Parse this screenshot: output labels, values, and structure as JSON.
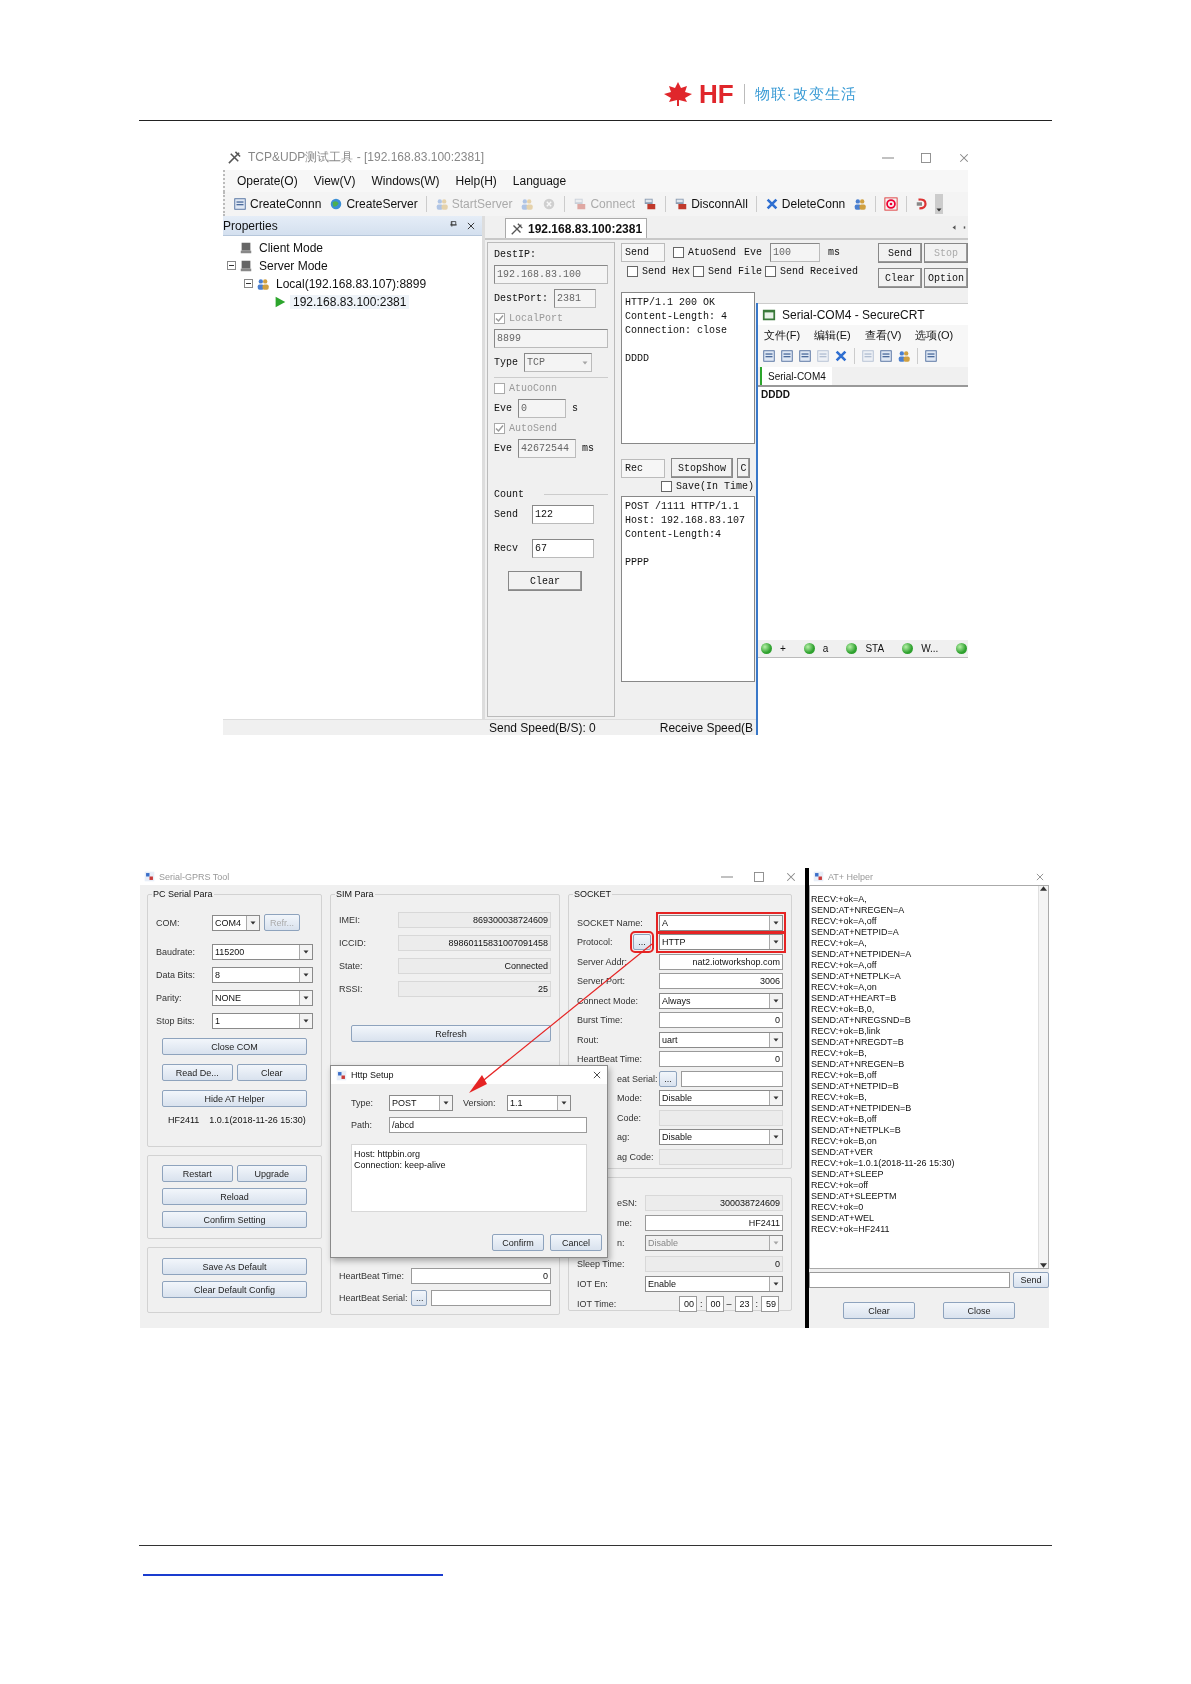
{
  "header": {
    "brand": "HF",
    "slogan": "物联·改变生活"
  },
  "tcp_tool": {
    "title": "TCP&UDP测试工具 - [192.168.83.100:2381]",
    "menu": [
      "Operate(O)",
      "View(V)",
      "Windows(W)",
      "Help(H)",
      "Language"
    ],
    "toolbar": [
      {
        "kind": "button",
        "label": "CreateConnn",
        "disabled": false
      },
      {
        "kind": "button",
        "label": "CreateServer",
        "disabled": false
      },
      {
        "kind": "separator"
      },
      {
        "kind": "button",
        "label": "StartServer",
        "disabled": true
      },
      {
        "kind": "icon",
        "disabled": true
      },
      {
        "kind": "icon",
        "disabled": true
      },
      {
        "kind": "separator"
      },
      {
        "kind": "button",
        "label": "Connect",
        "disabled": true
      },
      {
        "kind": "icon",
        "disabled": false
      },
      {
        "kind": "separator"
      },
      {
        "kind": "button",
        "label": "DisconnAll",
        "disabled": false
      },
      {
        "kind": "separator"
      },
      {
        "kind": "button",
        "label": "DeleteConn",
        "disabled": false
      },
      {
        "kind": "icon",
        "disabled": false
      },
      {
        "kind": "separator"
      },
      {
        "kind": "icon",
        "disabled": false
      },
      {
        "kind": "separator"
      },
      {
        "kind": "icon",
        "disabled": false
      }
    ],
    "properties": {
      "title": "Properties",
      "tree": [
        {
          "label": "Client Mode",
          "selected": false
        },
        {
          "label": "Server Mode",
          "expanded": true,
          "selected": false,
          "children": [
            {
              "label": "Local(192.168.83.107):8899",
              "expanded": true,
              "selected": false,
              "children": [
                {
                  "label": "192.168.83.100:2381",
                  "selected": true
                }
              ]
            }
          ]
        }
      ]
    },
    "tab": {
      "label": "192.168.83.100:2381",
      "selected": true
    },
    "settings": {
      "dest_ip": {
        "label": "DestIP:",
        "value": "192.168.83.100",
        "disabled": true
      },
      "dest_port": {
        "label": "DestPort:",
        "value": "2381",
        "disabled": true
      },
      "local_port": {
        "label": "LocalPort",
        "checked": true,
        "disabled": true,
        "value": "8899"
      },
      "type": {
        "label": "Type",
        "value": "TCP",
        "disabled": true
      },
      "auto_conn": {
        "label": "AtuoConn",
        "checked": false,
        "disabled": true,
        "eve_label": "Eve",
        "value": "0",
        "unit": "s"
      },
      "auto_send": {
        "label": "AutoSend",
        "checked": true,
        "disabled": true,
        "eve_label": "Eve",
        "value": "42672544",
        "unit": "ms"
      },
      "count": {
        "title": "Count",
        "send_label": "Send",
        "send": "122",
        "recv_label": "Recv",
        "recv": "67",
        "clear": "Clear"
      }
    },
    "send_panel": {
      "send_box": "Send",
      "atuo_send": {
        "label": "AtuoSend",
        "checked": false
      },
      "eve_label": "Eve",
      "eve_value": "100",
      "eve_unit": "ms",
      "buttons": [
        {
          "label": "Send",
          "disabled": false
        },
        {
          "label": "Stop",
          "disabled": true
        },
        {
          "label": "Clear",
          "disabled": false
        },
        {
          "label": "Option",
          "disabled": false
        }
      ],
      "options": [
        {
          "label": "Send Hex",
          "checked": false
        },
        {
          "label": "Send File",
          "checked": false
        },
        {
          "label": "Send Received",
          "checked": false
        }
      ],
      "text": "HTTP/1.1 200 OK\nContent-Length: 4\nConnection: close\n\nDDDD"
    },
    "recv_panel": {
      "rec_box": "Rec",
      "buttons": [
        "StopShow",
        "C"
      ],
      "save": {
        "label": "Save(In Time)",
        "checked": false
      },
      "text": "POST /1111 HTTP/1.1\nHost: 192.168.83.107\nContent-Length:4\n\nPPPP"
    },
    "status": [
      "Send Speed(B/S): 0",
      "Receive Speed(B"
    ]
  },
  "securecrt": {
    "title": "Serial-COM4 - SecureCRT",
    "menu": [
      "文件(F)",
      "编辑(E)",
      "查看(V)",
      "选项(O)"
    ],
    "tab": {
      "label": "Serial-COM4",
      "selected": true
    },
    "text": "DDDD",
    "status": [
      {
        "kind": "labeled",
        "label": "+"
      },
      {
        "kind": "labeled",
        "label": "a"
      },
      {
        "kind": "labeled",
        "label": "STA"
      },
      {
        "kind": "labeled",
        "label": "W..."
      },
      {
        "kind": "dot"
      }
    ]
  },
  "gprs_tool": {
    "title": "Serial-GPRS Tool",
    "pc_serial": {
      "title": "PC Serial Para",
      "com": {
        "label": "COM:",
        "value": "COM4",
        "refresh": "Refr..."
      },
      "fields": [
        {
          "label": "Baudrate:",
          "value": "115200"
        },
        {
          "label": "Data Bits:",
          "value": "8"
        },
        {
          "label": "Parity:",
          "value": "NONE"
        },
        {
          "label": "Stop Bits:",
          "value": "1"
        }
      ],
      "close": "Close COM",
      "read": "Read De...",
      "clear": "Clear",
      "hide": "Hide AT Helper",
      "model": "HF2411",
      "version": "1.0.1(2018-11-26 15:30)"
    },
    "device_buttons": [
      [
        "Restart",
        "Upgrade"
      ],
      [
        "Reload"
      ],
      [
        "Confirm Setting"
      ]
    ],
    "default_buttons": [
      "Save As Default",
      "Clear Default Config"
    ],
    "sim": {
      "title": "SIM Para",
      "fields": [
        {
          "label": "IMEI:",
          "value": "869300038724609"
        },
        {
          "label": "ICCID:",
          "value": "89860115831007091458"
        },
        {
          "label": "State:",
          "value": "Connected"
        },
        {
          "label": "RSSI:",
          "value": "25"
        }
      ],
      "refresh": "Refresh"
    },
    "heartbeat": {
      "time_label": "HeartBeat Time:",
      "time": "0",
      "serial_label": "HeartBeat Serial:",
      "more": "..."
    },
    "socket": {
      "title": "SOCKET",
      "fields": [
        {
          "kind": "select",
          "label": "SOCKET Name:",
          "value": "A",
          "highlighted": true
        },
        {
          "kind": "select",
          "label": "Protocol:",
          "value": "HTTP",
          "more": "...",
          "highlighted": true
        },
        {
          "kind": "input",
          "label": "Server Addr:",
          "value": "nat2.iotworkshop.com"
        },
        {
          "kind": "input",
          "label": "Server Port:",
          "value": "3006"
        },
        {
          "kind": "select",
          "label": "Connect Mode:",
          "value": "Always"
        },
        {
          "kind": "input",
          "label": "Burst Time:",
          "value": "0"
        },
        {
          "kind": "select",
          "label": "Rout:",
          "value": "uart"
        },
        {
          "kind": "input",
          "label": "HeartBeat Time:",
          "value": "0"
        },
        {
          "kind": "more_input",
          "label": "eat Serial:",
          "more": "...",
          "partly_covered": true
        },
        {
          "kind": "select",
          "label": "Mode:",
          "value": "Disable",
          "partly_covered": true
        },
        {
          "kind": "input",
          "label": "Code:",
          "disabled": true,
          "partly_covered": true
        },
        {
          "kind": "select",
          "label": "ag:",
          "value": "Disable",
          "partly_covered": true
        },
        {
          "kind": "input",
          "label": "ag Code:",
          "disabled": true,
          "partly_covered": true
        }
      ]
    },
    "socket2": {
      "fields": [
        {
          "kind": "input",
          "label": "eSN:",
          "value": "300038724609",
          "disabled": true,
          "partly_covered": true
        },
        {
          "kind": "input",
          "label": "me:",
          "value": "HF2411",
          "partly_covered": true
        },
        {
          "kind": "select",
          "label": "n:",
          "value": "Disable",
          "disabled": true,
          "partly_covered": true
        },
        {
          "kind": "input",
          "label": "Sleep Time:",
          "value": "0",
          "disabled": true
        },
        {
          "kind": "select",
          "label": "IOT En:",
          "value": "Enable"
        },
        {
          "kind": "time",
          "label": "IOT Time:",
          "parts": [
            {
              "kind": "box",
              "text": "00"
            },
            {
              "kind": "sep",
              "text": ":"
            },
            {
              "kind": "box",
              "text": "00"
            },
            {
              "kind": "sep",
              "text": "–"
            },
            {
              "kind": "box",
              "text": "23"
            },
            {
              "kind": "sep",
              "text": ":"
            },
            {
              "kind": "box",
              "text": "59"
            }
          ]
        }
      ]
    },
    "http_dialog": {
      "title": "Http Setup",
      "type_label": "Type:",
      "type": "POST",
      "version_label": "Version:",
      "version": "1.1",
      "path_label": "Path:",
      "path": "/abcd",
      "headers": "Host: httpbin.org\nConnection: keep-alive",
      "buttons": [
        "Confirm",
        "Cancel"
      ]
    },
    "annotation_arrow": true
  },
  "at_helper": {
    "title": "AT+ Helper",
    "log": [
      "RECV:+ok=A,",
      "SEND:AT+NREGEN=A",
      "RECV:+ok=A,off",
      "SEND:AT+NETPID=A",
      "RECV:+ok=A,",
      "SEND:AT+NETPIDEN=A",
      "RECV:+ok=A,off",
      "SEND:AT+NETPLK=A",
      "RECV:+ok=A,on",
      "SEND:AT+HEART=B",
      "RECV:+ok=B,0,",
      "SEND:AT+NREGSND=B",
      "RECV:+ok=B,link",
      "SEND:AT+NREGDT=B",
      "RECV:+ok=B,",
      "SEND:AT+NREGEN=B",
      "RECV:+ok=B,off",
      "SEND:AT+NETPID=B",
      "RECV:+ok=B,",
      "SEND:AT+NETPIDEN=B",
      "RECV:+ok=B,off",
      "SEND:AT+NETPLK=B",
      "RECV:+ok=B,on",
      "SEND:AT+VER",
      "RECV:+ok=1.0.1(2018-11-26 15:30)",
      "SEND:AT+SLEEP",
      "RECV:+ok=off",
      "SEND:AT+SLEEPTM",
      "RECV:+ok=0",
      "SEND:AT+WEL",
      "RECV:+ok=HF2411"
    ],
    "send": "Send",
    "buttons": [
      "Clear",
      "Close"
    ]
  }
}
